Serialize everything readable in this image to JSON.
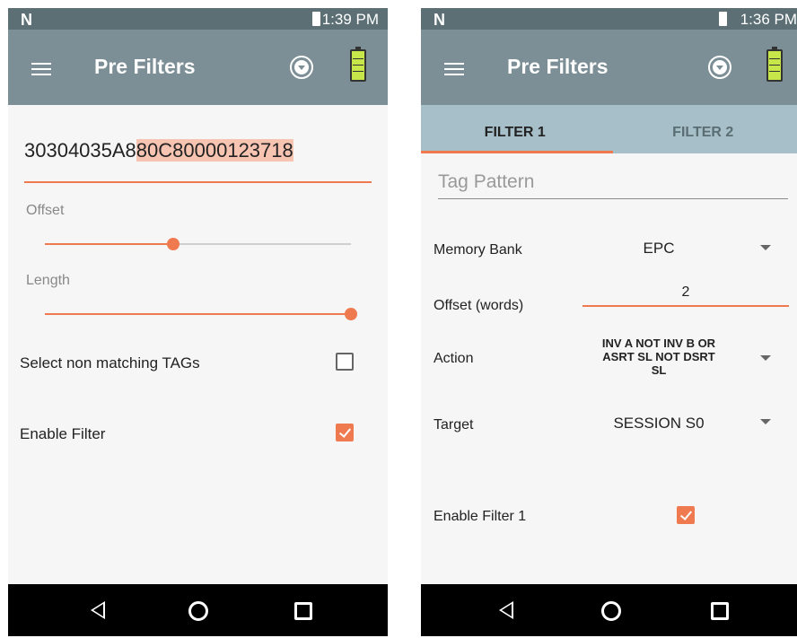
{
  "left": {
    "status": {
      "time": "1:39 PM"
    },
    "appbar": {
      "title": "Pre Filters"
    },
    "tag_value": {
      "prefix": "30304035A8",
      "highlighted": "80C80000123718"
    },
    "offset": {
      "label": "Offset",
      "level_percent": 42
    },
    "length": {
      "label": "Length",
      "level_percent": 100
    },
    "non_matching": {
      "label": "Select non matching TAGs",
      "checked": false
    },
    "enable_filter": {
      "label": "Enable Filter",
      "checked": true
    }
  },
  "right": {
    "status": {
      "time": "1:36 PM"
    },
    "appbar": {
      "title": "Pre Filters"
    },
    "tabs": [
      {
        "label": "FILTER 1",
        "active": true
      },
      {
        "label": "FILTER 2",
        "active": false
      }
    ],
    "tag_pattern": {
      "placeholder": "Tag Pattern"
    },
    "memory_bank": {
      "label": "Memory Bank",
      "value": "EPC"
    },
    "offset_words": {
      "label": "Offset (words)",
      "value": "2"
    },
    "action": {
      "label": "Action",
      "value_line1": "INV A NOT INV B OR",
      "value_line2": "ASRT SL NOT DSRT",
      "value_line3": "SL"
    },
    "target": {
      "label": "Target",
      "value": "SESSION S0"
    },
    "enable_filter1": {
      "label": "Enable Filter 1",
      "checked": true
    }
  },
  "colors": {
    "accent": "#f07a4f",
    "appbar": "#7c8f96",
    "statusbar": "#5b6f75",
    "tabs": "#a7bfc8"
  },
  "icons": [
    "n-logo-icon",
    "battery-status-icon",
    "hamburger-menu-icon",
    "dropdown-circle-icon",
    "battery-level-icon",
    "back-nav-icon",
    "home-nav-icon",
    "recents-nav-icon",
    "chevron-down-icon",
    "checkbox-icon"
  ]
}
